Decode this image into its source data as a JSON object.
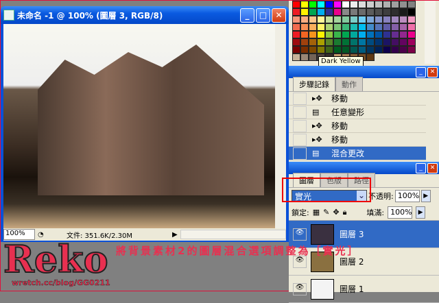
{
  "document": {
    "title": "未命名 -1 @ 100% (圖層 3, RGB/8)",
    "zoom": "100%",
    "file_info": "文件: 351.6K/2.30M",
    "window_buttons": [
      "_",
      "□",
      "✕"
    ]
  },
  "swatches": {
    "tooltip": "Dark Yellow",
    "rows": [
      [
        "#ff0000",
        "#ffff00",
        "#00ff00",
        "#00ffff",
        "#0000ff",
        "#ff00ff",
        "#ffffff",
        "#ececec",
        "#dcdcdc",
        "#cdcdcd",
        "#c0c0c0",
        "#b0b0b0",
        "#a0a0a0",
        "#909090",
        "#808080"
      ],
      [
        "#ed1c24",
        "#fff200",
        "#00a651",
        "#00aeef",
        "#2e3192",
        "#ec008c",
        "#898989",
        "#7a7a7a",
        "#6b6b6b",
        "#5c5c5c",
        "#4d4d4d",
        "#3e3e3e",
        "#2f2f2f",
        "#1a1a1a",
        "#000000"
      ],
      [
        "#f7977a",
        "#f9ad81",
        "#fdc68a",
        "#fff79a",
        "#c4df9b",
        "#a3d39c",
        "#82ca9d",
        "#7bcdc8",
        "#6ecff6",
        "#7ea7d8",
        "#8493ca",
        "#8882be",
        "#a187be",
        "#bc8dbf",
        "#f49ac2"
      ],
      [
        "#f26c4f",
        "#f68e55",
        "#fbaf5c",
        "#fff467",
        "#acd372",
        "#7cc576",
        "#3bb878",
        "#1abbb4",
        "#00bff3",
        "#438ccb",
        "#5574b9",
        "#605ca8",
        "#855fa8",
        "#a763a8",
        "#f06ea9"
      ],
      [
        "#ed1c24",
        "#f26522",
        "#f7941d",
        "#fff200",
        "#8dc73f",
        "#39b54a",
        "#00a651",
        "#00a99d",
        "#00aeef",
        "#0072bc",
        "#0054a5",
        "#2e3192",
        "#662d91",
        "#92278f",
        "#ec008c"
      ],
      [
        "#9e0b0f",
        "#a0410d",
        "#a36209",
        "#aba000",
        "#598527",
        "#1a7b30",
        "#007236",
        "#00746b",
        "#0076a3",
        "#004b80",
        "#003471",
        "#1b1464",
        "#440e62",
        "#630460",
        "#9e005d"
      ],
      [
        "#790000",
        "#7b2e00",
        "#7d4900",
        "#827b00",
        "#406618",
        "#005e20",
        "#005826",
        "#005952",
        "#005b7f",
        "#003663",
        "#002157",
        "#0d004c",
        "#32004b",
        "#4b0049",
        "#7b0046"
      ],
      [
        "#c7b299",
        "#998675",
        "#736357",
        "#534741",
        "#37302d",
        "#c69c6d",
        "#a67c52",
        "#8c6239",
        "#754c24",
        "#603913"
      ]
    ]
  },
  "history": {
    "tabs": [
      "步驟記錄",
      "動作"
    ],
    "items": [
      {
        "icon": "move-icon",
        "label": "移動"
      },
      {
        "icon": "transform-icon",
        "label": "任意變形"
      },
      {
        "icon": "move-icon",
        "label": "移動"
      },
      {
        "icon": "move-icon",
        "label": "移動"
      },
      {
        "icon": "blend-change-icon",
        "label": "混合更改",
        "selected": true
      }
    ]
  },
  "layers": {
    "tabs": [
      "圖層",
      "色版",
      "路徑"
    ],
    "blend_mode": "實光",
    "opacity_label": "不透明:",
    "opacity": "100%",
    "lock_label": "鎖定:",
    "fill_label": "填滿:",
    "fill": "100%",
    "items": [
      {
        "name": "圖層 3",
        "selected": true,
        "thumb": "#3a3040"
      },
      {
        "name": "圖層 2",
        "selected": false,
        "thumb": "#8a7040"
      },
      {
        "name": "圖層 1",
        "selected": false,
        "thumb": "#f4f4f4"
      }
    ]
  },
  "watermark": {
    "logo": "Reko",
    "url": "wretch.cc/blog/GG0211"
  },
  "caption": "將背景素材2的圖層混合選項調整為［實光］"
}
